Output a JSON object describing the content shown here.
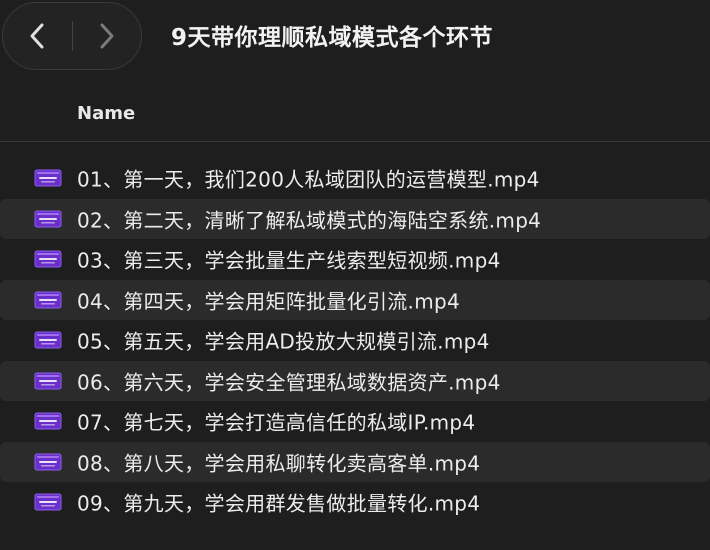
{
  "toolbar": {
    "back_icon": "chevron-left-icon",
    "forward_icon": "chevron-right-icon",
    "title": "9天带你理顺私域模式各个环节"
  },
  "columns": {
    "name": "Name"
  },
  "colors": {
    "background": "#1e1e1e",
    "row_alt": "#2b2b2b",
    "icon_purple": "#6b2fc9"
  },
  "files": [
    {
      "name": "01、第一天，我们200人私域团队的运营模型.mp4",
      "icon": "video-file-icon"
    },
    {
      "name": "02、第二天，清晰了解私域模式的海陆空系统.mp4",
      "icon": "video-file-icon"
    },
    {
      "name": "03、第三天，学会批量生产线索型短视频.mp4",
      "icon": "video-file-icon"
    },
    {
      "name": "04、第四天，学会用矩阵批量化引流.mp4",
      "icon": "video-file-icon"
    },
    {
      "name": "05、第五天，学会用AD投放大规模引流.mp4",
      "icon": "video-file-icon"
    },
    {
      "name": "06、第六天，学会安全管理私域数据资产.mp4",
      "icon": "video-file-icon"
    },
    {
      "name": "07、第七天，学会打造高信任的私域IP.mp4",
      "icon": "video-file-icon"
    },
    {
      "name": "08、第八天，学会用私聊转化卖高客单.mp4",
      "icon": "video-file-icon"
    },
    {
      "name": "09、第九天，学会用群发售做批量转化.mp4",
      "icon": "video-file-icon"
    }
  ]
}
